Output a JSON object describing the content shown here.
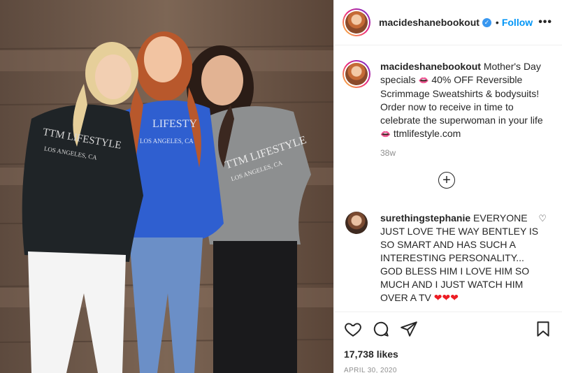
{
  "post": {
    "username": "macideshanebookout",
    "verified_icon": "verified-badge-icon",
    "separator": "•",
    "follow_label": "Follow",
    "more_label": "•••",
    "caption_username": "macideshanebookout",
    "caption_part1": "Mother's Day specials",
    "caption_part2": "40% OFF Reversible Scrimmage Sweatshirts & bodysuits! Order now to receive in time to celebrate the superwoman in your life",
    "caption_part3": "ttmlifestyle.com",
    "emoji_lips": "👄",
    "time_ago": "38w",
    "load_more_label": "+"
  },
  "comment": {
    "username": "surethingstephanie",
    "text": "EVERYONE JUST LOVE THE WAY BENTLEY IS SO SMART AND HAS SUCH A INTERESTING PERSONALITY... GOD BLESS HIM I LOVE HIM SO MUCH AND I JUST WATCH HIM OVER A TV",
    "hearts": "❤❤❤",
    "like_icon": "♡"
  },
  "footer": {
    "likes": "17,738 likes",
    "date": "APRIL 30, 2020"
  },
  "photo": {
    "sweatshirt_left_text": "TTM LIFESTYLE",
    "sweatshirt_left_sub": "LOS ANGELES, CA",
    "sweatshirt_mid_text": "LIFESTY",
    "sweatshirt_mid_sub": "LOS ANGELES, CA",
    "sweatshirt_right_text": "TTM LIFESTYLE",
    "sweatshirt_right_sub": "LOS ANGELES, CA"
  },
  "colors": {
    "accent": "#0095f6",
    "verified": "#3897f0",
    "wood": "#6b5546",
    "sweater_black": "#1f2427",
    "sweater_blue": "#2f5fd0",
    "sweater_grey": "#8d8f90"
  }
}
